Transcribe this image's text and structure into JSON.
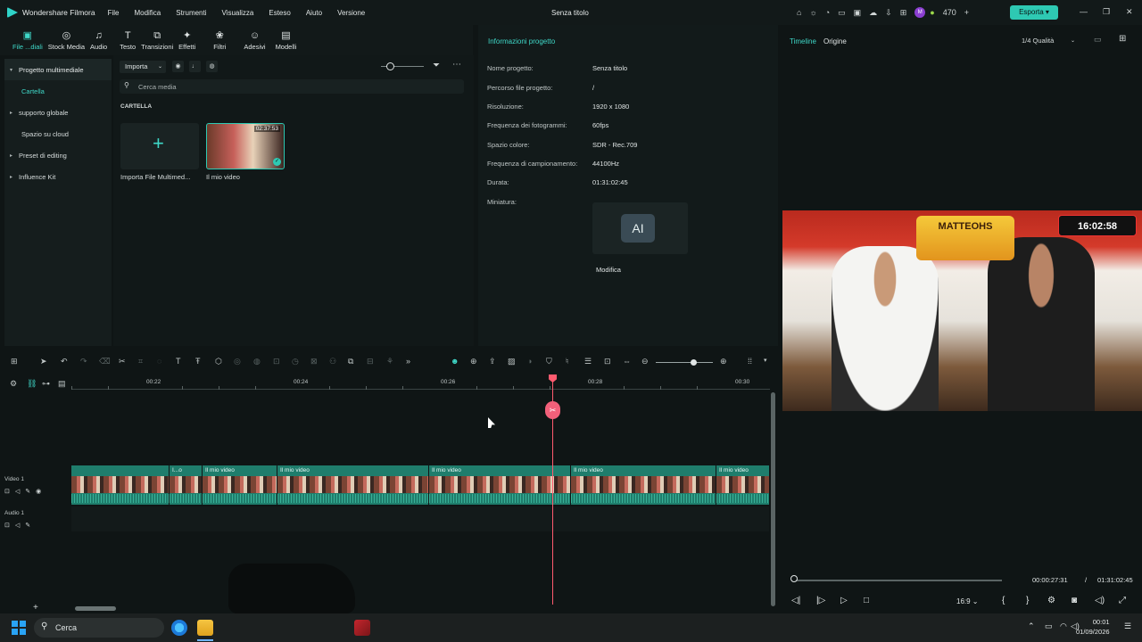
{
  "app": {
    "name": "Wondershare Filmora",
    "doc_title": "Senza titolo",
    "credits": "470",
    "export_label": "Esporta",
    "avatar_letter": "M"
  },
  "menu": [
    "File",
    "Modifica",
    "Strumenti",
    "Visualizza",
    "Esteso",
    "Aiuto",
    "Versione"
  ],
  "toolbar": [
    {
      "label": "File ...diali",
      "icon": "media-icon",
      "glyph": "▣"
    },
    {
      "label": "Stock Media",
      "icon": "stock-media-icon",
      "glyph": "◎"
    },
    {
      "label": "Audio",
      "icon": "audio-icon",
      "glyph": "♫"
    },
    {
      "label": "Testo",
      "icon": "text-icon",
      "glyph": "T"
    },
    {
      "label": "Transizioni",
      "icon": "transitions-icon",
      "glyph": "⧉"
    },
    {
      "label": "Effetti",
      "icon": "effects-icon",
      "glyph": "✦"
    },
    {
      "label": "Filtri",
      "icon": "filters-icon",
      "glyph": "❀"
    },
    {
      "label": "Adesivi",
      "icon": "stickers-icon",
      "glyph": "☺"
    },
    {
      "label": "Modelli",
      "icon": "templates-icon",
      "glyph": "▤"
    }
  ],
  "sidebar": {
    "items": [
      {
        "label": "Progetto multimediale",
        "caret": "▾"
      },
      {
        "label": "Cartella",
        "caret": ""
      },
      {
        "label": "supporto globale",
        "caret": "▸"
      },
      {
        "label": "Spazio su cloud",
        "caret": ""
      },
      {
        "label": "Preset di editing",
        "caret": "▸"
      },
      {
        "label": "Influence Kit",
        "caret": "▸"
      }
    ]
  },
  "media": {
    "import_label": "Importa",
    "search_placeholder": "Cerca media",
    "section_label": "CARTELLA",
    "import_tile_label": "Importa File Multimed...",
    "video_tile_label": "Il mio video",
    "video_duration": "02:37:53"
  },
  "info": {
    "title": "Informazioni progetto",
    "rows": [
      {
        "label": "Nome progetto:",
        "value": "Senza titolo"
      },
      {
        "label": "Percorso file progetto:",
        "value": "/"
      },
      {
        "label": "Risoluzione:",
        "value": "1920 x 1080"
      },
      {
        "label": "Frequenza dei fotogrammi:",
        "value": "60fps"
      },
      {
        "label": "Spazio colore:",
        "value": "SDR - Rec.709"
      },
      {
        "label": "Frequenza di campionamento:",
        "value": "44100Hz"
      },
      {
        "label": "Durata:",
        "value": "01:31:02:45"
      },
      {
        "label": "Miniatura:",
        "value": ""
      }
    ],
    "thumb_icon": "AI",
    "edit_label": "Modifica"
  },
  "player": {
    "tab_timeline": "Timeline",
    "tab_source": "Origine",
    "quality": "1/4 Qualità",
    "current_time": "00:00:27:31",
    "separator": "/",
    "total_time": "01:31:02:45",
    "aspect": "16:9",
    "video_banner": "MATTEOHS",
    "video_clock": "16:02:58",
    "progress": 0.004
  },
  "timeline": {
    "ticks": [
      "00:22",
      "00:24",
      "00:26",
      "00:28",
      "00:30"
    ],
    "video_track_label": "Video 1",
    "audio_track_label": "Audio 1",
    "clips": [
      "",
      "I...o",
      "Il mio video",
      "Il mio video",
      "Il mio video",
      "Il mio video",
      "Il mio video"
    ]
  },
  "taskbar": {
    "search_label": "Cerca",
    "time": "00:01",
    "date": "01/09/2026"
  }
}
